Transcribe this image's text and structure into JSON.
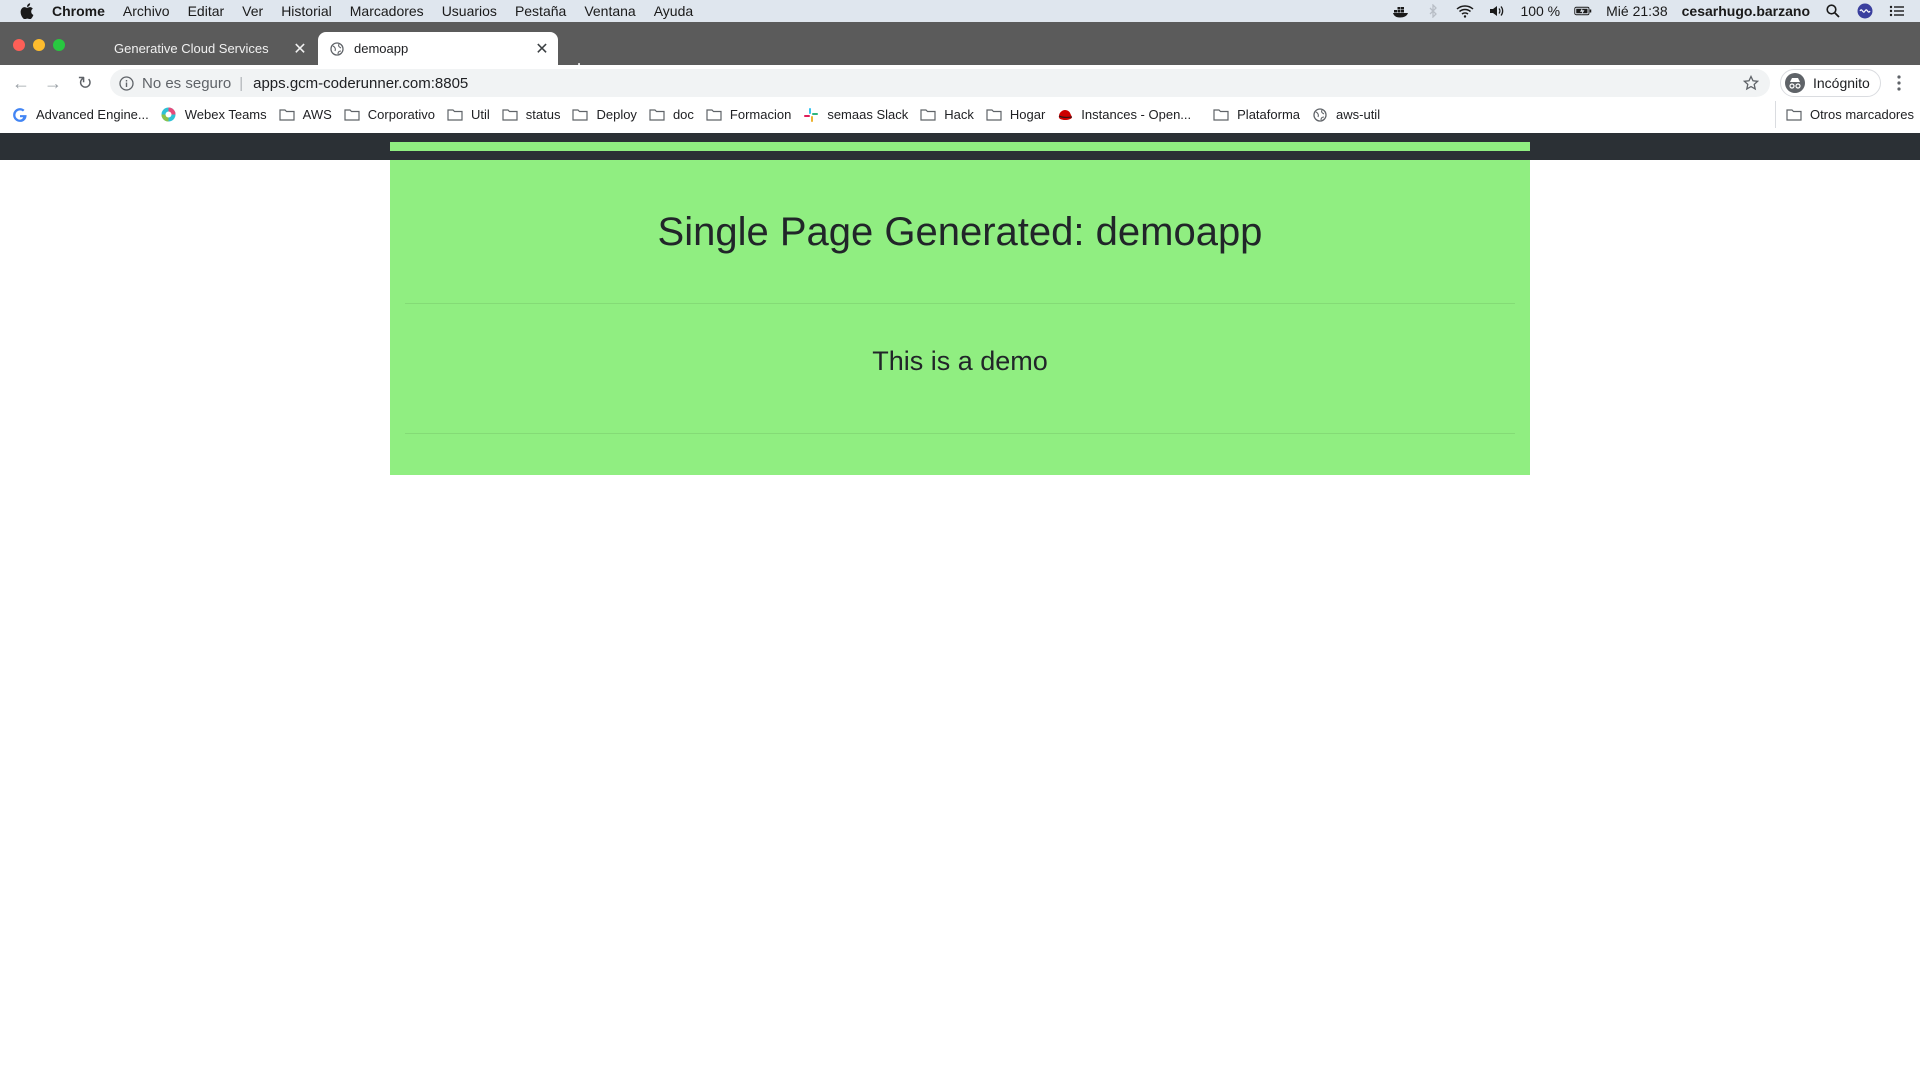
{
  "os_menu": {
    "app_name": "Chrome",
    "items": [
      "Archivo",
      "Editar",
      "Ver",
      "Historial",
      "Marcadores",
      "Usuarios",
      "Pestaña",
      "Ventana",
      "Ayuda"
    ],
    "battery": "100 %",
    "clock": "Mié 21:38",
    "user": "cesarhugo.barzano"
  },
  "tabs": [
    {
      "title": "Generative Cloud Services",
      "close": "✕"
    },
    {
      "title": "demoapp",
      "close": "✕"
    }
  ],
  "new_tab": "+",
  "toolbar": {
    "back": "←",
    "forward": "→",
    "reload": "↻",
    "security": "No es seguro",
    "separator": "|",
    "url": "apps.gcm-coderunner.com:8805",
    "incognito": "Incógnito"
  },
  "bookmarks": {
    "items": [
      {
        "label": "Advanced Engine...",
        "icon": "google-icon"
      },
      {
        "label": "Webex Teams",
        "icon": "webex-icon"
      },
      {
        "label": "AWS",
        "icon": "folder-icon"
      },
      {
        "label": "Corporativo",
        "icon": "folder-icon"
      },
      {
        "label": "Util",
        "icon": "folder-icon"
      },
      {
        "label": "status",
        "icon": "folder-icon"
      },
      {
        "label": "Deploy",
        "icon": "folder-icon"
      },
      {
        "label": "doc",
        "icon": "folder-icon"
      },
      {
        "label": "Formacion",
        "icon": "folder-icon"
      },
      {
        "label": "semaas Slack",
        "icon": "slack-icon"
      },
      {
        "label": "Hack",
        "icon": "folder-icon"
      },
      {
        "label": "Hogar",
        "icon": "folder-icon"
      },
      {
        "label": "Instances - Open...",
        "icon": "redhat-icon"
      },
      {
        "label": "Plataforma",
        "icon": "folder-icon"
      },
      {
        "label": "aws-util",
        "icon": "globe-icon"
      }
    ],
    "other": "Otros marcadores"
  },
  "page": {
    "heading": "Single Page Generated: demoapp",
    "lead": "This is a demo",
    "accent_color": "#90ee81",
    "topbar_color": "#2b3035"
  }
}
